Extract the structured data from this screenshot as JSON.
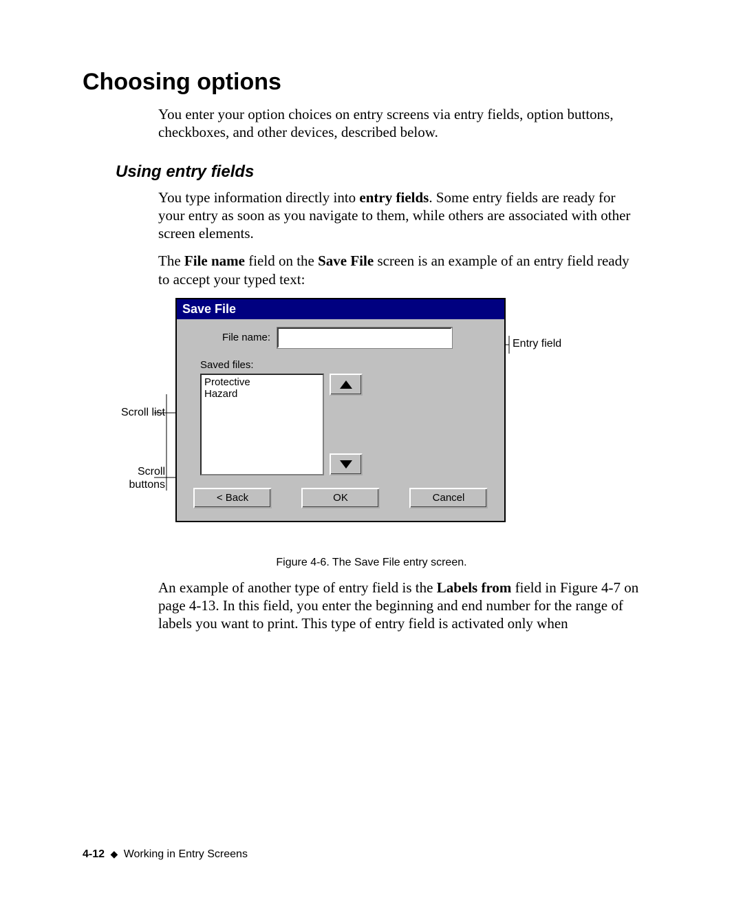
{
  "heading": "Choosing options",
  "intro": "You enter your option choices on entry screens via entry fields, option buttons, checkboxes, and other devices, described below.",
  "subheading": "Using entry fields",
  "para1_a": "You type information directly into ",
  "para1_b": "entry fields",
  "para1_c": ". Some entry fields are ready for your entry as soon as you navigate to them, while others are associated with other screen elements.",
  "para2_a": "The ",
  "para2_b": "File name",
  "para2_c": " field on the ",
  "para2_d": "Save File",
  "para2_e": " screen is an example of an entry field ready to accept your typed text:",
  "callouts": {
    "scroll_list": "Scroll list",
    "scroll_buttons": "Scroll\nbuttons",
    "entry_field": "Entry field"
  },
  "dialog": {
    "title": "Save File",
    "file_name_label": "File name:",
    "file_name_value": "",
    "saved_files_label": "Saved files:",
    "list_items": [
      "Protective",
      "Hazard"
    ],
    "back": "< Back",
    "ok": "OK",
    "cancel": "Cancel"
  },
  "caption": "Figure 4-6. The Save File entry screen.",
  "para3_a": "An example of another type of entry field is the ",
  "para3_b": "Labels from",
  "para3_c": " field in Figure 4-7 on page 4-13. In this field, you enter the beginning and end number for the range of labels you want to print. This type of entry field is activated only when",
  "footer": {
    "page": "4-12",
    "diamond": "◆",
    "section": "Working in Entry Screens"
  }
}
